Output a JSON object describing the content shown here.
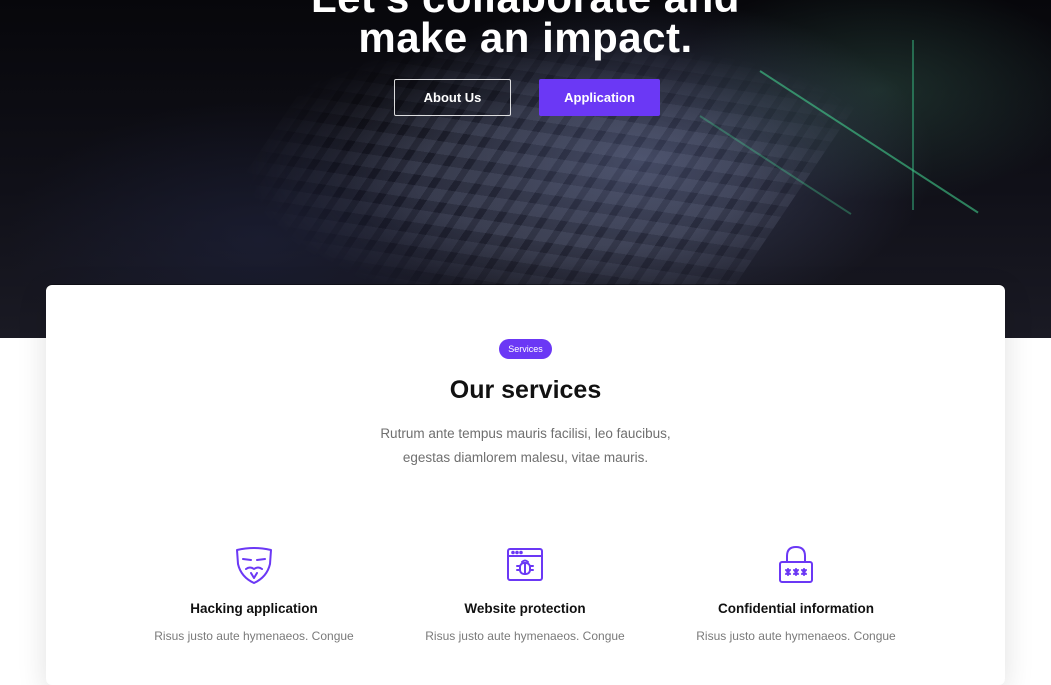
{
  "hero": {
    "title_line1": "Let's collaborate and",
    "title_line2": "make an impact.",
    "about_button": "About Us",
    "application_button": "Application"
  },
  "services": {
    "badge": "Services",
    "title": "Our services",
    "description_line1": "Rutrum ante tempus mauris facilisi, leo faucibus,",
    "description_line2": "egestas diamlorem malesu, vitae mauris.",
    "items": [
      {
        "icon": "anonymous-mask-icon",
        "title": "Hacking application",
        "text": "Risus justo aute hymenaeos. Congue"
      },
      {
        "icon": "browser-bug-icon",
        "title": "Website protection",
        "text": "Risus justo aute hymenaeos. Congue"
      },
      {
        "icon": "padlock-password-icon",
        "title": "Confidential information",
        "text": "Risus justo aute hymenaeos. Congue"
      }
    ]
  },
  "colors": {
    "accent": "#6b38f5",
    "hero_bg": "#0b0b10",
    "heading": "#111111",
    "body_text": "#6f6f6f"
  }
}
